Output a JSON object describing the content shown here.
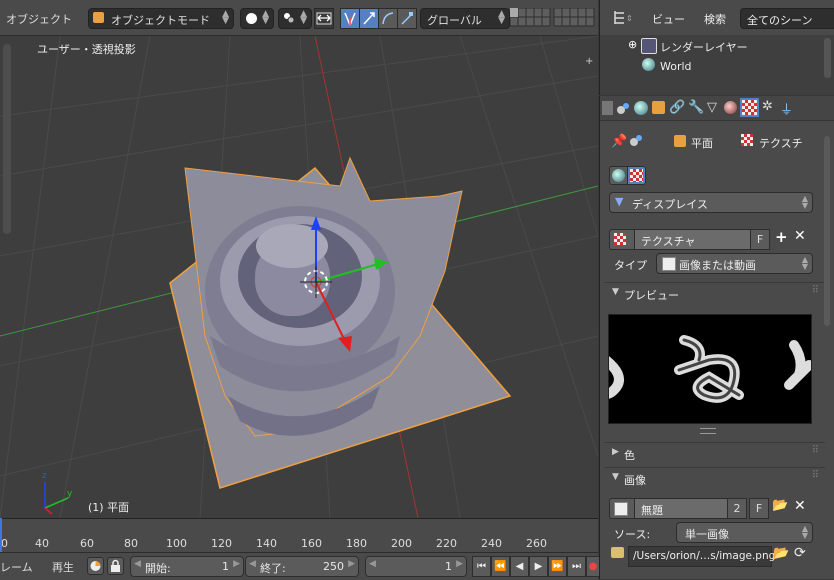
{
  "header": {
    "object_menu": "オブジェクト",
    "mode": "オブジェクトモード",
    "orientation": "グローバル"
  },
  "viewport": {
    "view_label": "ユーザー・透視投影",
    "object_label": "(1) 平面"
  },
  "timeline": {
    "ticks": [
      "0",
      "20",
      "40",
      "60",
      "80",
      "100",
      "120",
      "140",
      "160",
      "180",
      "200",
      "220",
      "240",
      "260"
    ]
  },
  "bottom_bar": {
    "frame_menu": "レーム",
    "play_menu": "再生",
    "start_label": "開始:",
    "start_value": "1",
    "end_label": "終了:",
    "end_value": "250",
    "current_frame": "1"
  },
  "outliner": {
    "view_menu": "ビュー",
    "search_menu": "検索",
    "scene_filter": "全てのシーン",
    "items": [
      {
        "label": "レンダーレイヤー"
      },
      {
        "label": "World"
      }
    ]
  },
  "properties": {
    "breadcrumb_object": "平面",
    "breadcrumb_texture": "テクスチ",
    "influence_dropdown": "ディスプレイス",
    "texture_name": "テクスチャ",
    "fake_user_label": "F",
    "type_label": "タイプ",
    "type_value": "画像または動画",
    "preview_section": "プレビュー",
    "color_section": "色",
    "image_section": "画像",
    "image_name": "無題",
    "image_users": "2",
    "image_fake": "F",
    "source_label": "ソース:",
    "source_value": "単一画像",
    "filepath": "/Users/orion/…s/image.png"
  },
  "colors": {
    "accent_blue": "#5680c2",
    "panel_bg": "#4a4a4a",
    "viewport_bg": "#3e3e3e",
    "selection_orange": "#f0a040"
  }
}
